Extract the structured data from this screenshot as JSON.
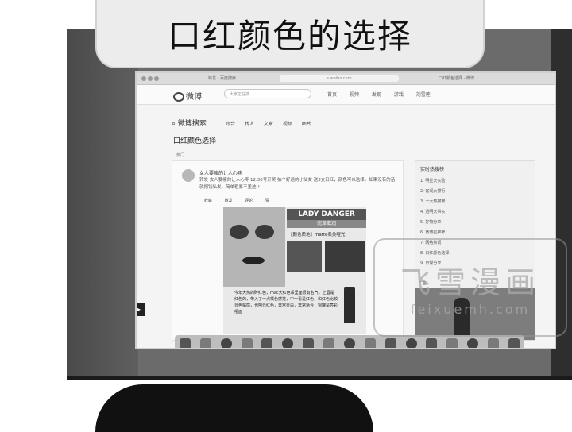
{
  "title": "口红颜色的选择",
  "browser": {
    "address": "s.weibo.com",
    "tab_left": "转发 - 百度搜索",
    "tab_right": "口红颜色选择 - 微博"
  },
  "weibo": {
    "logo": "微博",
    "search_placeholder": "大家正在搜",
    "nav": [
      "首页",
      "视频",
      "发现",
      "游戏",
      "刘雪莲"
    ],
    "search_title": "微博搜索",
    "subtabs": [
      "综合",
      "找人",
      "文章",
      "视频",
      "图片"
    ],
    "query": "口红颜色选择",
    "hot_label": "热门",
    "post": {
      "author": "女人要瘦的让人心疼",
      "text": "转发 女人要瘦的让人心疼 12.30号开奖 抽个好运的小仙女 送3支口红，颜色可以选择。如果没有的话就把钱私发，简单粗暴不墨迹!!",
      "actions": [
        "收藏",
        "转发",
        "评论",
        "赞"
      ],
      "brand": "LADY DANGER",
      "brand_sub": "亮泽滋润",
      "tag": "【颜色质地】matte柔美哑光",
      "desc": "今年大热的砖红色，mac大红色系里面很有名气，上唇是红色的，带入了一点橘色感觉，中一看是红色，和红色比较显色橘感，也叫元红色，非常显白，非常适合，铜罐是亮彩哑面"
    },
    "sidebar": {
      "heading": "实时热搜榜",
      "rows": [
        "1. 明星大实验",
        "2. 客观大排行",
        "3. 十大热搜榜",
        "4. 透明大事实",
        "5. 好物分享",
        "6. 微博星推荐",
        "7. 网络热词",
        "8. 口红颜色选择",
        "9. 日常分享"
      ],
      "ad_label": "广告"
    }
  },
  "watermark": {
    "text": "飞雪漫画",
    "url": "feixuemh.com"
  }
}
